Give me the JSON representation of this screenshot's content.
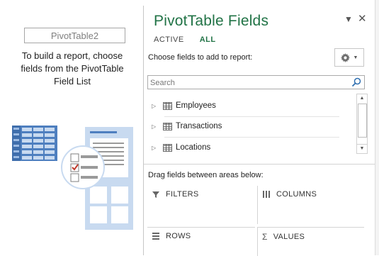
{
  "placeholder": {
    "pivot_name": "PivotTable2",
    "instructions_line1": "To build a report, choose",
    "instructions_line2": "fields from the PivotTable",
    "instructions_line3": "Field List"
  },
  "pane": {
    "title": "PivotTable Fields",
    "tabs": [
      {
        "label": "ACTIVE"
      },
      {
        "label": "ALL"
      }
    ],
    "choose_label": "Choose fields to add to report:",
    "search_placeholder": "Search",
    "fields": [
      {
        "label": "Employees"
      },
      {
        "label": "Transactions"
      },
      {
        "label": "Locations"
      }
    ],
    "drag_label": "Drag fields between areas below:",
    "areas": {
      "filters": "FILTERS",
      "columns": "COLUMNS",
      "rows": "ROWS",
      "values": "VALUES"
    }
  },
  "colors": {
    "accent": "#217346",
    "illustration_blue": "#4e7fbf",
    "illustration_light": "#c8daf0",
    "checkmark": "#c0392b"
  },
  "icons": {
    "pane_dropdown": "chevron-down-icon",
    "pane_close": "close-icon",
    "settings": "gear-icon",
    "search": "search-icon",
    "expand": "triangle-right-icon",
    "table": "table-icon"
  }
}
